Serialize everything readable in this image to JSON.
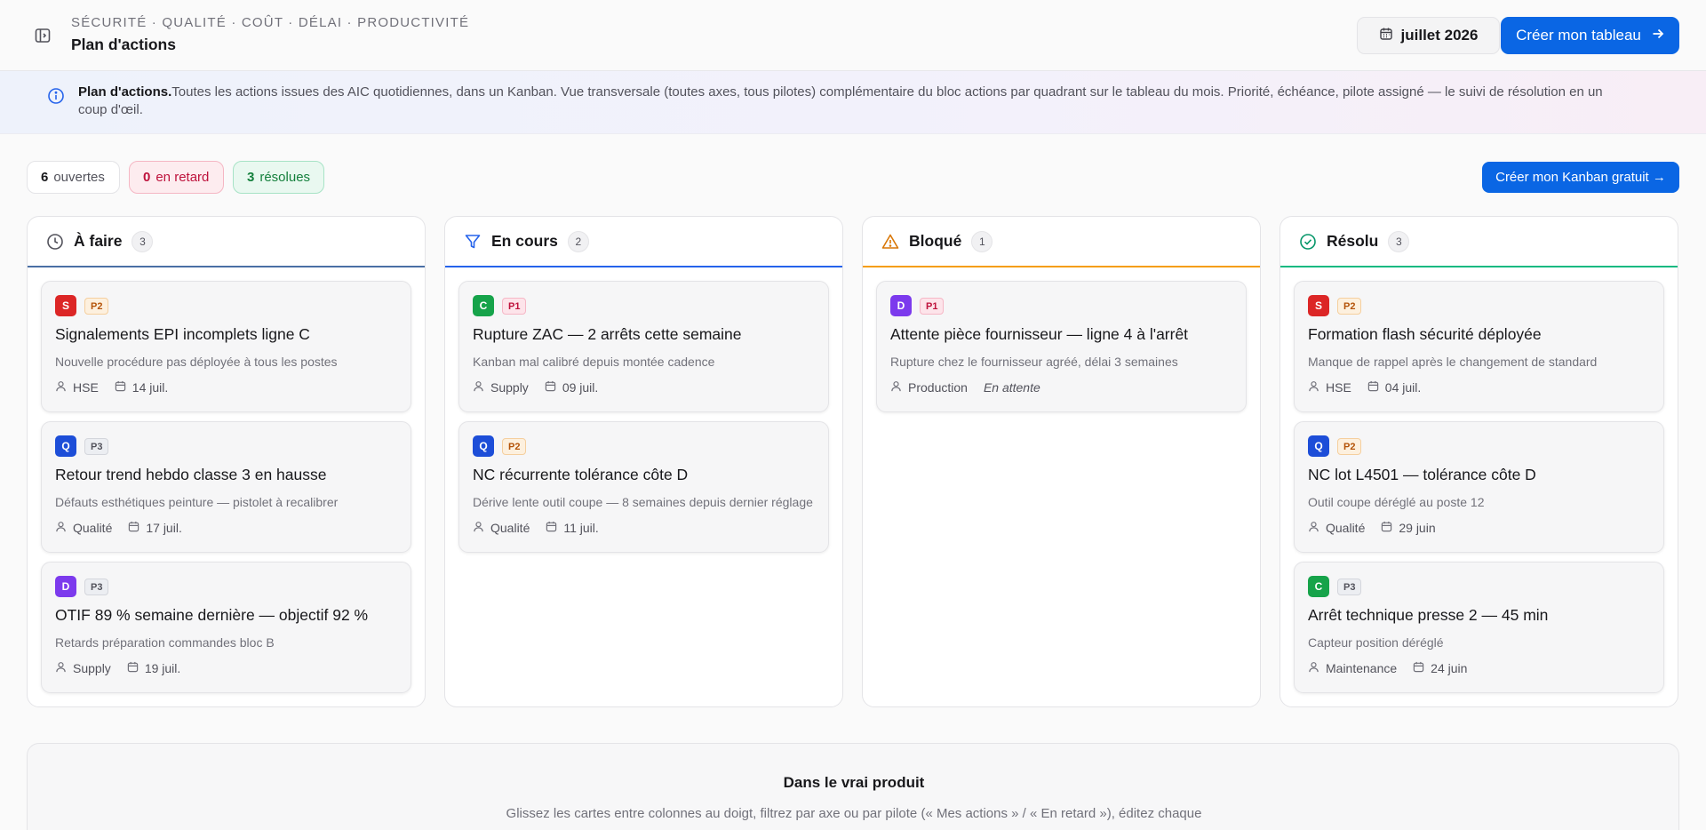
{
  "header": {
    "eyebrow": "SÉCURITÉ · QUALITÉ · COÛT · DÉLAI · PRODUCTIVITÉ",
    "title": "Plan d'actions",
    "month_label": "juillet 2026",
    "create_board_label": "Créer mon tableau"
  },
  "info": {
    "title": "Plan d'actions.",
    "text": "Toutes les actions issues des AIC quotidiennes, dans un Kanban. Vue transversale (toutes axes, tous pilotes) complémentaire du bloc actions par quadrant sur le tableau du mois. Priorité, échéance, pilote assigné — le suivi de résolution en un coup d'œil."
  },
  "stats": {
    "open_count": "6",
    "open_label": "ouvertes",
    "late_count": "0",
    "late_label": "en retard",
    "resolved_count": "3",
    "resolved_label": "résolues"
  },
  "kanban_cta": "Créer mon Kanban gratuit →",
  "colors": {
    "accent": "#0a66e4",
    "todo": "#4a6fa5",
    "in_progress": "#2563eb",
    "blocked": "#f59e0b",
    "resolved": "#10b981",
    "axis_S": "#dc2626",
    "axis_Q": "#1d4ed8",
    "axis_C": "#16a34a",
    "axis_D": "#7c3aed"
  },
  "columns": [
    {
      "title": "À faire",
      "count": "3",
      "icon": "clock-icon",
      "cards": [
        {
          "axis": "S",
          "priority": "P2",
          "title": "Signalements EPI incomplets ligne C",
          "desc": "Nouvelle procédure pas déployée à tous les postes",
          "owner": "HSE",
          "date": "14 juil."
        },
        {
          "axis": "Q",
          "priority": "P3",
          "title": "Retour trend hebdo classe 3 en hausse",
          "desc": "Défauts esthétiques peinture — pistolet à recalibrer",
          "owner": "Qualité",
          "date": "17 juil."
        },
        {
          "axis": "D",
          "priority": "P3",
          "title": "OTIF 89 % semaine dernière — objectif 92 %",
          "desc": "Retards préparation commandes bloc B",
          "owner": "Supply",
          "date": "19 juil."
        }
      ]
    },
    {
      "title": "En cours",
      "count": "2",
      "icon": "filter-icon",
      "cards": [
        {
          "axis": "C",
          "priority": "P1",
          "title": "Rupture ZAC — 2 arrêts cette semaine",
          "desc": "Kanban mal calibré depuis montée cadence",
          "owner": "Supply",
          "date": "09 juil."
        },
        {
          "axis": "Q",
          "priority": "P2",
          "title": "NC récurrente tolérance côte D",
          "desc": "Dérive lente outil coupe — 8 semaines depuis dernier réglage",
          "owner": "Qualité",
          "date": "11 juil."
        }
      ]
    },
    {
      "title": "Bloqué",
      "count": "1",
      "icon": "warning-icon",
      "cards": [
        {
          "axis": "D",
          "priority": "P1",
          "title": "Attente pièce fournisseur — ligne 4 à l'arrêt",
          "desc": "Rupture chez le fournisseur agréé, délai 3 semaines",
          "owner": "Production",
          "status": "En attente"
        }
      ]
    },
    {
      "title": "Résolu",
      "count": "3",
      "icon": "check-circle-icon",
      "cards": [
        {
          "axis": "S",
          "priority": "P2",
          "title": "Formation flash sécurité déployée",
          "desc": "Manque de rappel après le changement de standard",
          "owner": "HSE",
          "date": "04 juil."
        },
        {
          "axis": "Q",
          "priority": "P2",
          "title": "NC lot L4501 — tolérance côte D",
          "desc": "Outil coupe déréglé au poste 12",
          "owner": "Qualité",
          "date": "29 juin"
        },
        {
          "axis": "C",
          "priority": "P3",
          "title": "Arrêt technique presse 2 — 45 min",
          "desc": "Capteur position déréglé",
          "owner": "Maintenance",
          "date": "24 juin"
        }
      ]
    }
  ],
  "product": {
    "title": "Dans le vrai produit",
    "text": "Glissez les cartes entre colonnes au doigt, filtrez par axe ou par pilote (« Mes actions » / « En retard »), éditez chaque carte"
  }
}
